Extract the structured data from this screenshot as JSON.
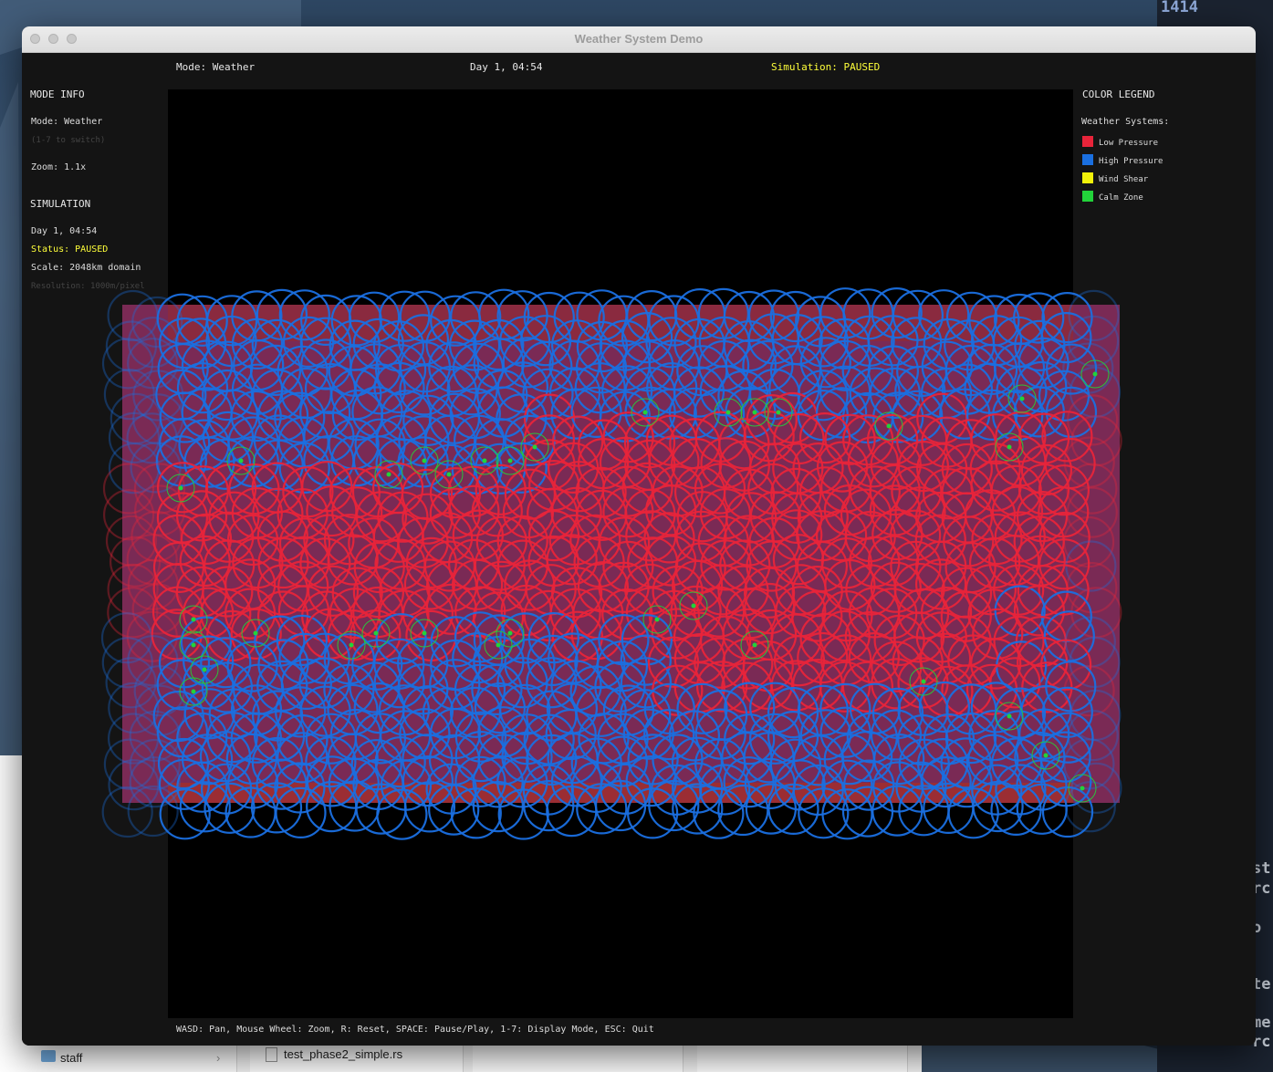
{
  "window": {
    "title": "Weather System Demo"
  },
  "topbar": {
    "mode": "Mode: Weather",
    "datetime": "Day 1, 04:54",
    "simulation": "Simulation: PAUSED"
  },
  "left_panel": {
    "mode_info_title": "MODE INFO",
    "mode": "Mode: Weather",
    "mode_hint": "(1-7 to switch)",
    "zoom": "Zoom: 1.1x",
    "simulation_title": "SIMULATION",
    "datetime": "Day 1, 04:54",
    "status": "Status: PAUSED",
    "scale": "Scale: 2048km domain",
    "resolution": "Resolution: 1000m/pixel"
  },
  "legend": {
    "title": "COLOR LEGEND",
    "subtitle": "Weather Systems:",
    "items": [
      {
        "label": "Low Pressure",
        "color": "#e8243a"
      },
      {
        "label": "High Pressure",
        "color": "#1a6fe0"
      },
      {
        "label": "Wind Shear",
        "color": "#f2f20a"
      },
      {
        "label": "Calm Zone",
        "color": "#22d33a"
      }
    ]
  },
  "footer": {
    "help": "WASD: Pan, Mouse Wheel: Zoom, R: Reset, SPACE: Pause/Play, 1-7: Display Mode, ESC: Quit"
  },
  "background": {
    "terminal_number": "1414",
    "finder_items": [
      "staff",
      "test_phase2_simple.rs"
    ]
  },
  "colors": {
    "low_pressure": "#e8243a",
    "high_pressure": "#1a6fe0",
    "calm_zone": "#22d33a",
    "field_fill": "#7a2a55",
    "status_yellow": "#ffff3a"
  }
}
